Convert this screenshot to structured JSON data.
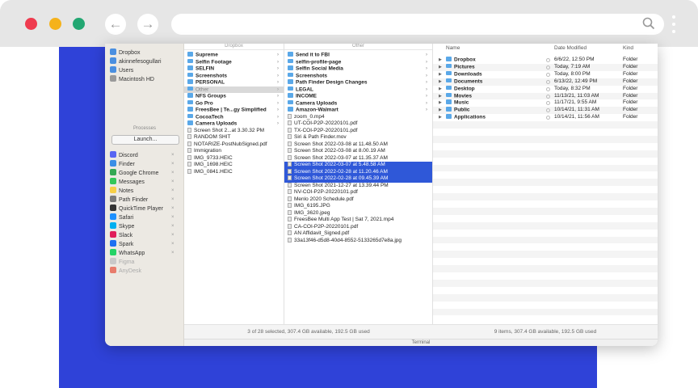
{
  "browser": {
    "url": ""
  },
  "sidebar": {
    "locations": [
      {
        "label": "Dropbox",
        "color": "#4a8fe0"
      },
      {
        "label": "akinnefesogullari",
        "color": "#4a8fe0"
      },
      {
        "label": "Users",
        "color": "#4a8fe0"
      },
      {
        "label": "Macintosh HD",
        "color": "#9a9a9a"
      }
    ],
    "processes_header": "Processes",
    "launch_label": "Launch...",
    "apps": [
      {
        "label": "Discord",
        "color": "#5865f2",
        "x": "×",
        "dim": false
      },
      {
        "label": "Finder",
        "color": "#3a8ee6",
        "x": "×",
        "dim": false
      },
      {
        "label": "Google Chrome",
        "color": "#34a853",
        "x": "×",
        "dim": false
      },
      {
        "label": "Messages",
        "color": "#34c759",
        "x": "×",
        "dim": false
      },
      {
        "label": "Notes",
        "color": "#f7cf46",
        "x": "×",
        "dim": false
      },
      {
        "label": "Path Finder",
        "color": "#7a7a7a",
        "x": "×",
        "dim": false
      },
      {
        "label": "QuickTime Player",
        "color": "#333333",
        "x": "×",
        "dim": false
      },
      {
        "label": "Safari",
        "color": "#1e90ff",
        "x": "×",
        "dim": false
      },
      {
        "label": "Skype",
        "color": "#00aff0",
        "x": "×",
        "dim": false
      },
      {
        "label": "Slack",
        "color": "#e01e5a",
        "x": "×",
        "dim": false
      },
      {
        "label": "Spark",
        "color": "#1d6ff2",
        "x": "×",
        "dim": false
      },
      {
        "label": "WhatsApp",
        "color": "#25d366",
        "x": "×",
        "dim": false
      },
      {
        "label": "Figma",
        "color": "#c9c9c9",
        "x": "",
        "dim": true
      },
      {
        "label": "AnyDesk",
        "color": "#e87c6c",
        "x": "",
        "dim": true
      }
    ]
  },
  "col1": {
    "header": "Dropbox",
    "rows": [
      {
        "label": "Supreme",
        "type": "folder",
        "bold": true,
        "arrow": true
      },
      {
        "label": "Selfin Footage",
        "type": "folder",
        "bold": true,
        "arrow": true
      },
      {
        "label": "SELFIN",
        "type": "folder",
        "bold": true,
        "arrow": true
      },
      {
        "label": "Screenshots",
        "type": "folder",
        "bold": true,
        "arrow": true
      },
      {
        "label": "PERSONAL",
        "type": "folder",
        "bold": true,
        "arrow": true
      },
      {
        "label": "Other",
        "type": "folder",
        "bold": false,
        "arrow": true,
        "state": "dim"
      },
      {
        "label": "NFS Groups",
        "type": "folder",
        "bold": true,
        "arrow": true
      },
      {
        "label": "Go Pro",
        "type": "folder",
        "bold": true,
        "arrow": true
      },
      {
        "label": "FreesBee | Te...gy Simplified",
        "type": "folder",
        "bold": true,
        "arrow": true
      },
      {
        "label": "CocoaTech",
        "type": "folder",
        "bold": true,
        "arrow": true
      },
      {
        "label": "Camera Uploads",
        "type": "folder",
        "bold": true,
        "arrow": true
      },
      {
        "label": "Screen Shot 2...at 3.30.32 PM",
        "type": "file"
      },
      {
        "label": "RANDOM SHIT",
        "type": "file"
      },
      {
        "label": "NOTARIZE-PostNubSigned.pdf",
        "type": "file"
      },
      {
        "label": "Immigration",
        "type": "file"
      },
      {
        "label": "IMG_9733.HEIC",
        "type": "file"
      },
      {
        "label": "IMG_1698.HEIC",
        "type": "file"
      },
      {
        "label": "IMG_0841.HEIC",
        "type": "file"
      }
    ],
    "status": "3 of 28 selected, 307.4 GB available, 192.5 GB used"
  },
  "col2": {
    "header": "Other",
    "rows": [
      {
        "label": "Send it to FBI",
        "type": "folder",
        "bold": true,
        "arrow": true
      },
      {
        "label": "selfin-profile-page",
        "type": "folder",
        "bold": true,
        "arrow": true
      },
      {
        "label": "Selfin Social Media",
        "type": "folder",
        "bold": true,
        "arrow": true
      },
      {
        "label": "Screenshots",
        "type": "folder",
        "bold": true,
        "arrow": true
      },
      {
        "label": "Path Finder Design Changes",
        "type": "folder",
        "bold": true,
        "arrow": true
      },
      {
        "label": "LEGAL",
        "type": "folder",
        "bold": true,
        "arrow": true
      },
      {
        "label": "INCOME",
        "type": "folder",
        "bold": true,
        "arrow": true
      },
      {
        "label": "Camera Uploads",
        "type": "folder",
        "bold": true,
        "arrow": true
      },
      {
        "label": "Amazon-Walmart",
        "type": "folder",
        "bold": true,
        "arrow": true
      },
      {
        "label": "zoom_0.mp4",
        "type": "file"
      },
      {
        "label": "UT-COI-P2P-20220101.pdf",
        "type": "file"
      },
      {
        "label": "TX-COI-P2P-20220101.pdf",
        "type": "file"
      },
      {
        "label": "Siri & Path Finder.mov",
        "type": "file"
      },
      {
        "label": "Screen Shot 2022-03-08 at 11.48.50 AM",
        "type": "file"
      },
      {
        "label": "Screen Shot 2022-03-08 at 8.00.19 AM",
        "type": "file"
      },
      {
        "label": "Screen Shot 2022-03-07 at 11.35.37 AM",
        "type": "file"
      },
      {
        "label": "Screen Shot 2022-03-07 at 5.48.58 AM",
        "type": "file",
        "state": "sel"
      },
      {
        "label": "Screen Shot 2022-02-28 at 11.20.46 AM",
        "type": "file",
        "state": "sel"
      },
      {
        "label": "Screen Shot 2022-02-28 at 09.45.39 AM",
        "type": "file",
        "state": "sel"
      },
      {
        "label": "Screen Shot 2021-12-27 at 13.39.44 PM",
        "type": "file"
      },
      {
        "label": "NV-COI-P2P-20220101.pdf",
        "type": "file"
      },
      {
        "label": "Menlo 2020 Schedule.pdf",
        "type": "file"
      },
      {
        "label": "IMG_6195.JPG",
        "type": "file"
      },
      {
        "label": "IMG_3620.jpeg",
        "type": "file"
      },
      {
        "label": "FreesBee Multi App Test | Sat 7, 2021.mp4",
        "type": "file"
      },
      {
        "label": "CA-COI-P2P-20220101.pdf",
        "type": "file"
      },
      {
        "label": "AN Affidavit_Signed.pdf",
        "type": "file"
      },
      {
        "label": "33a13f46-d5d8-40d4-8552-5133265d7e8a.jpg",
        "type": "file"
      }
    ]
  },
  "detail": {
    "headers": {
      "name": "Name",
      "date": "Date Modified",
      "kind": "Kind"
    },
    "rows": [
      {
        "name": "Dropbox",
        "date": "6/6/22, 12:50 PM",
        "kind": "Folder"
      },
      {
        "name": "Pictures",
        "date": "Today, 7:19 AM",
        "kind": "Folder"
      },
      {
        "name": "Downloads",
        "date": "Today, 8:00 PM",
        "kind": "Folder"
      },
      {
        "name": "Documents",
        "date": "6/13/22, 12:49 PM",
        "kind": "Folder"
      },
      {
        "name": "Desktop",
        "date": "Today, 8:32 PM",
        "kind": "Folder"
      },
      {
        "name": "Movies",
        "date": "11/13/21, 11:03 AM",
        "kind": "Folder"
      },
      {
        "name": "Music",
        "date": "11/17/21, 9:55 AM",
        "kind": "Folder"
      },
      {
        "name": "Public",
        "date": "10/14/21, 11:31 AM",
        "kind": "Folder"
      },
      {
        "name": "Applications",
        "date": "10/14/21, 11:56 AM",
        "kind": "Folder"
      }
    ],
    "status": "9 items, 307.4 GB available, 192.5 GB used"
  },
  "terminal_label": "Terminal",
  "colors": {
    "accent": "#2f42d8",
    "selection": "#2f58d8",
    "folder": "#5aa8e8"
  }
}
